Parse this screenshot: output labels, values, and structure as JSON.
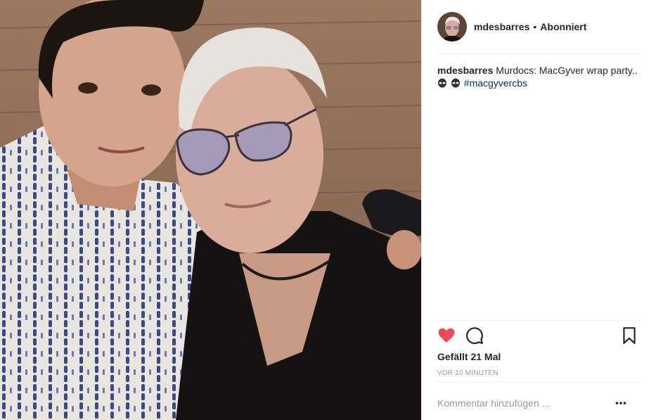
{
  "post": {
    "username": "mdesbarres",
    "separator": "•",
    "follow_status": "Abonniert",
    "caption": {
      "username": "mdesbarres",
      "text": "Murdocs: MacGyver wrap party..",
      "emoji": "alien-emoji alien-emoji",
      "hashtag": "#macgyvercbs"
    },
    "likes": "Gefällt 21 Mal",
    "timestamp": "VOR 10 MINUTEN",
    "comment_placeholder": "Kommentar hinzufügen ...",
    "icons": {
      "like": "heart-icon",
      "comment": "comment-icon",
      "save": "bookmark-icon",
      "more": "more-options-icon"
    },
    "colors": {
      "liked": "#ed4956",
      "hashtag": "#003569",
      "muted": "#999999",
      "divider": "#efefef"
    }
  }
}
